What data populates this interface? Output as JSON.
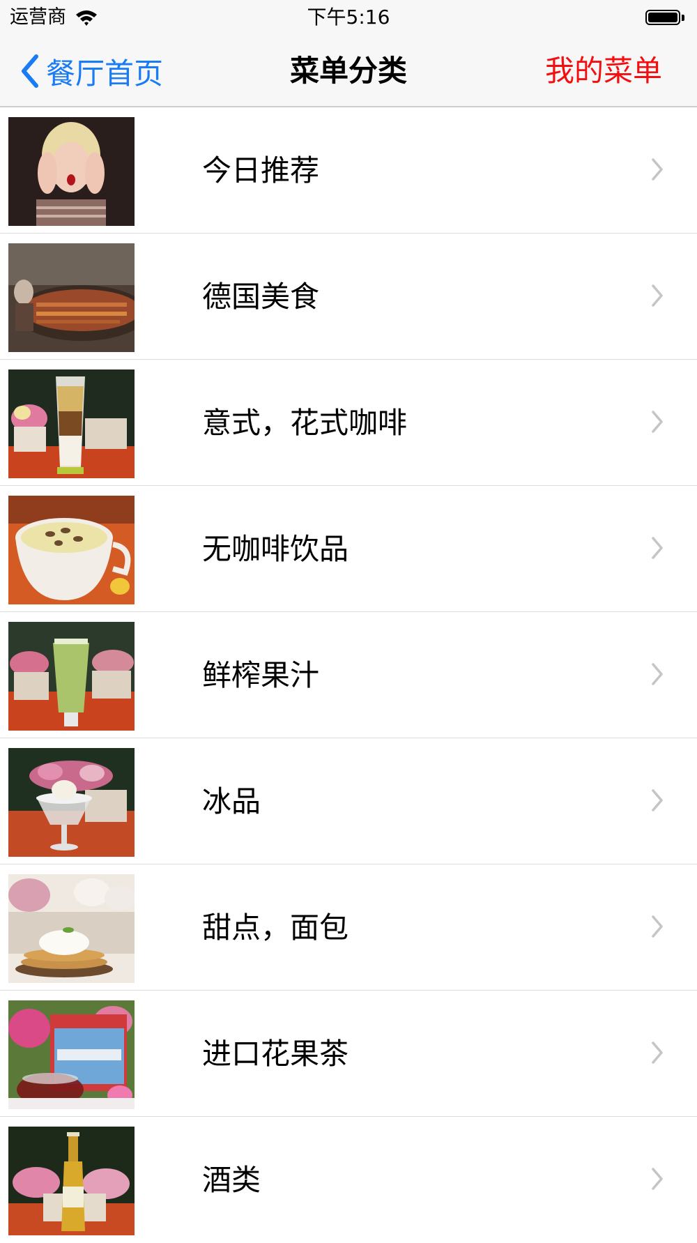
{
  "status_bar": {
    "carrier": "运营商",
    "time": "下午5:16"
  },
  "nav": {
    "back_label": "餐厅首页",
    "title": "菜单分类",
    "right_label": "我的菜单"
  },
  "colors": {
    "back_tint": "#1a7cf5",
    "right_tint": "#f30f0f"
  },
  "categories": [
    {
      "label": "今日推荐",
      "icon": "recommend-photo-icon"
    },
    {
      "label": "德国美食",
      "icon": "german-food-photo-icon"
    },
    {
      "label": "意式，花式咖啡",
      "icon": "coffee-photo-icon"
    },
    {
      "label": "无咖啡饮品",
      "icon": "non-coffee-drink-photo-icon"
    },
    {
      "label": "鲜榨果汁",
      "icon": "juice-photo-icon"
    },
    {
      "label": "冰品",
      "icon": "ice-dessert-photo-icon"
    },
    {
      "label": "甜点，面包",
      "icon": "dessert-bread-photo-icon"
    },
    {
      "label": "进口花果茶",
      "icon": "fruit-tea-photo-icon"
    },
    {
      "label": "酒类",
      "icon": "alcohol-photo-icon"
    }
  ]
}
